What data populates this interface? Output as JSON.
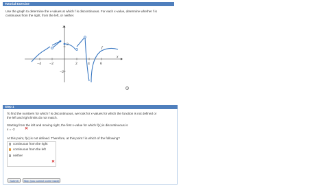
{
  "tutorial": {
    "title": "Tutorial Exercise",
    "intro_line1": "Use the graph to determine the x-values at which f is discontinuous. For each x-value, determine whether f is",
    "intro_line2": "continuous from the right, from the left, or neither."
  },
  "graph": {
    "y_axis_label": "y",
    "x_axis_label": "x",
    "function_label": "f",
    "tick_labels": [
      "−4",
      "−2",
      "2",
      "4",
      "6",
      "2",
      "−2"
    ]
  },
  "step": {
    "title": "Step 1",
    "hint_line1": "To find the numbers for which f is discontinuous, we look for x-values for which the function is not defined or",
    "hint_line2": "the left and right limits do not match.",
    "lead": "Starting from the left and moving right, the first x-value for which f(x) is discontinuous is",
    "answer_point": "x = -2",
    "question": "At this point, f(x) is not defined. Therefore, at this point f is which of the following?",
    "options": [
      "continuous from the right",
      "continuous from the left",
      "neither"
    ],
    "selected_option": 1
  },
  "buttons": {
    "submit": "Submit",
    "skip": "Skip (you cannot come back)"
  },
  "colors": {
    "header_bar": "#4f7fbd",
    "curve": "#3a78c2",
    "wrong_mark": "#d63030",
    "selected_radio": "#e08a1e"
  }
}
